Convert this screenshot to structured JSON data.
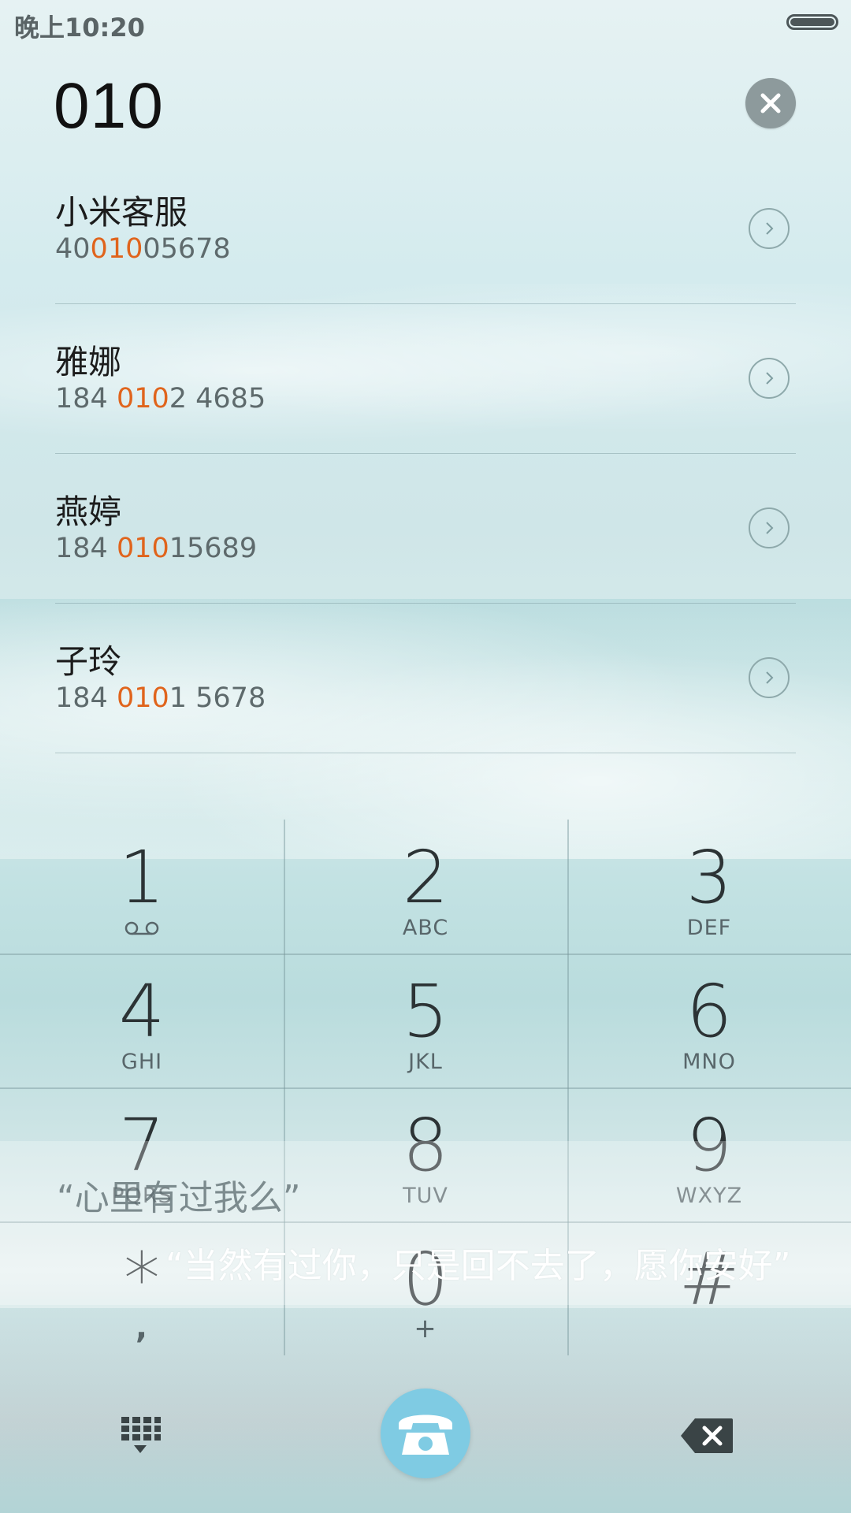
{
  "status_bar": {
    "time": "晚上10:20",
    "battery_level": 1.0
  },
  "dialer": {
    "input": "010"
  },
  "results": [
    {
      "name": "小米客服",
      "number_pre": "40",
      "number_hl": "010",
      "number_post": "05678"
    },
    {
      "name": "雅娜",
      "number_pre": "184 ",
      "number_hl": "010",
      "number_post": "2 4685"
    },
    {
      "name": "燕婷",
      "number_pre": "184 ",
      "number_hl": "010",
      "number_post": "15689"
    },
    {
      "name": "子玲",
      "number_pre": "184 ",
      "number_hl": "010",
      "number_post": "1 5678"
    }
  ],
  "keypad": [
    {
      "digit": "1",
      "letters": "",
      "icon": "voicemail-icon"
    },
    {
      "digit": "2",
      "letters": "ABC"
    },
    {
      "digit": "3",
      "letters": "DEF"
    },
    {
      "digit": "4",
      "letters": "GHI"
    },
    {
      "digit": "5",
      "letters": "JKL"
    },
    {
      "digit": "6",
      "letters": "MNO"
    },
    {
      "digit": "7",
      "letters": "PQRS"
    },
    {
      "digit": "8",
      "letters": "TUV"
    },
    {
      "digit": "9",
      "letters": "WXYZ"
    },
    {
      "digit": "*",
      "letters": ","
    },
    {
      "digit": "0",
      "letters": "+"
    },
    {
      "digit": "#",
      "letters": ""
    }
  ],
  "lyrics": {
    "line1": "“心里有过我么”",
    "line2": "“当然有过你，只是回不去了，愿你安好”"
  },
  "bottom_bar": {
    "dialpad_icon": "dialpad-grid-icon",
    "call_icon": "phone-icon",
    "backspace_icon": "backspace-icon"
  },
  "colors": {
    "highlight": "#e0641c",
    "call_button": "#7fcbe3"
  }
}
